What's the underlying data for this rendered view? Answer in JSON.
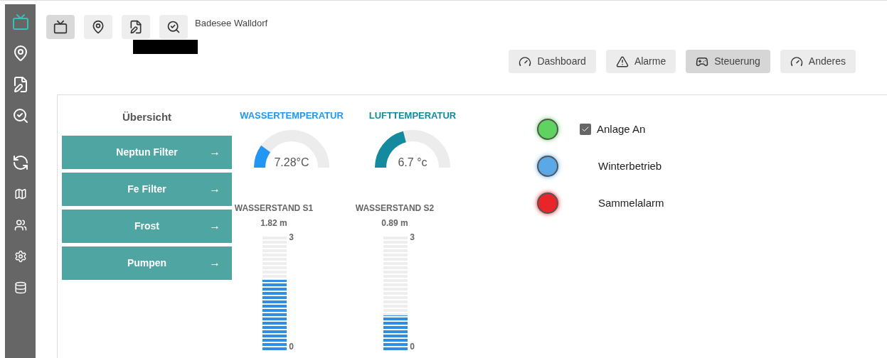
{
  "sidebar": {
    "items": [
      {
        "selected": true
      },
      {
        "selected": false
      },
      {
        "selected": false
      },
      {
        "selected": false
      },
      {
        "selected": false
      },
      {
        "selected": false
      },
      {
        "selected": false
      },
      {
        "selected": false
      },
      {
        "selected": false
      }
    ]
  },
  "toolbar": {
    "buttons": [
      {
        "selected": true
      },
      {
        "selected": false
      },
      {
        "selected": false
      },
      {
        "selected": false
      }
    ],
    "title": "Badesee Walldorf"
  },
  "tabs": [
    {
      "label": "Dashboard",
      "selected": false
    },
    {
      "label": "Alarme",
      "selected": false
    },
    {
      "label": "Steuerung",
      "selected": true
    },
    {
      "label": "Anderes",
      "selected": false
    }
  ],
  "overview": {
    "title": "Übersicht",
    "buttons": [
      {
        "label": "Neptun Filter",
        "arrow": "→"
      },
      {
        "label": "Fe Filter",
        "arrow": "→"
      },
      {
        "label": "Frost",
        "arrow": "→"
      },
      {
        "label": "Pumpen",
        "arrow": "→"
      }
    ]
  },
  "gauges": [
    {
      "title": "WASSERTEMPERATUR",
      "reading": "7.28°C",
      "color": "#2196f3"
    },
    {
      "title": "LUFTTEMPERATUR",
      "reading": "6.7 °c",
      "color": "#138a9e"
    }
  ],
  "water_levels": [
    {
      "title": "WASSERSTAND S1",
      "reading": "1.82 m",
      "level": 0.61,
      "scale_max": "3",
      "scale_min": "0"
    },
    {
      "title": "WASSERSTAND S2",
      "reading": "0.89 m",
      "level": 0.3,
      "scale_max": "3",
      "scale_min": "0"
    }
  ],
  "status": [
    {
      "kind": "checkbox",
      "label": "Anlage An",
      "checked": true,
      "color": "#5fd35f"
    },
    {
      "kind": "text",
      "label": "Winterbetrieb",
      "color": "#5aa9e6"
    },
    {
      "kind": "text",
      "label": "Sammelalarm",
      "color": "#e8262a"
    }
  ]
}
